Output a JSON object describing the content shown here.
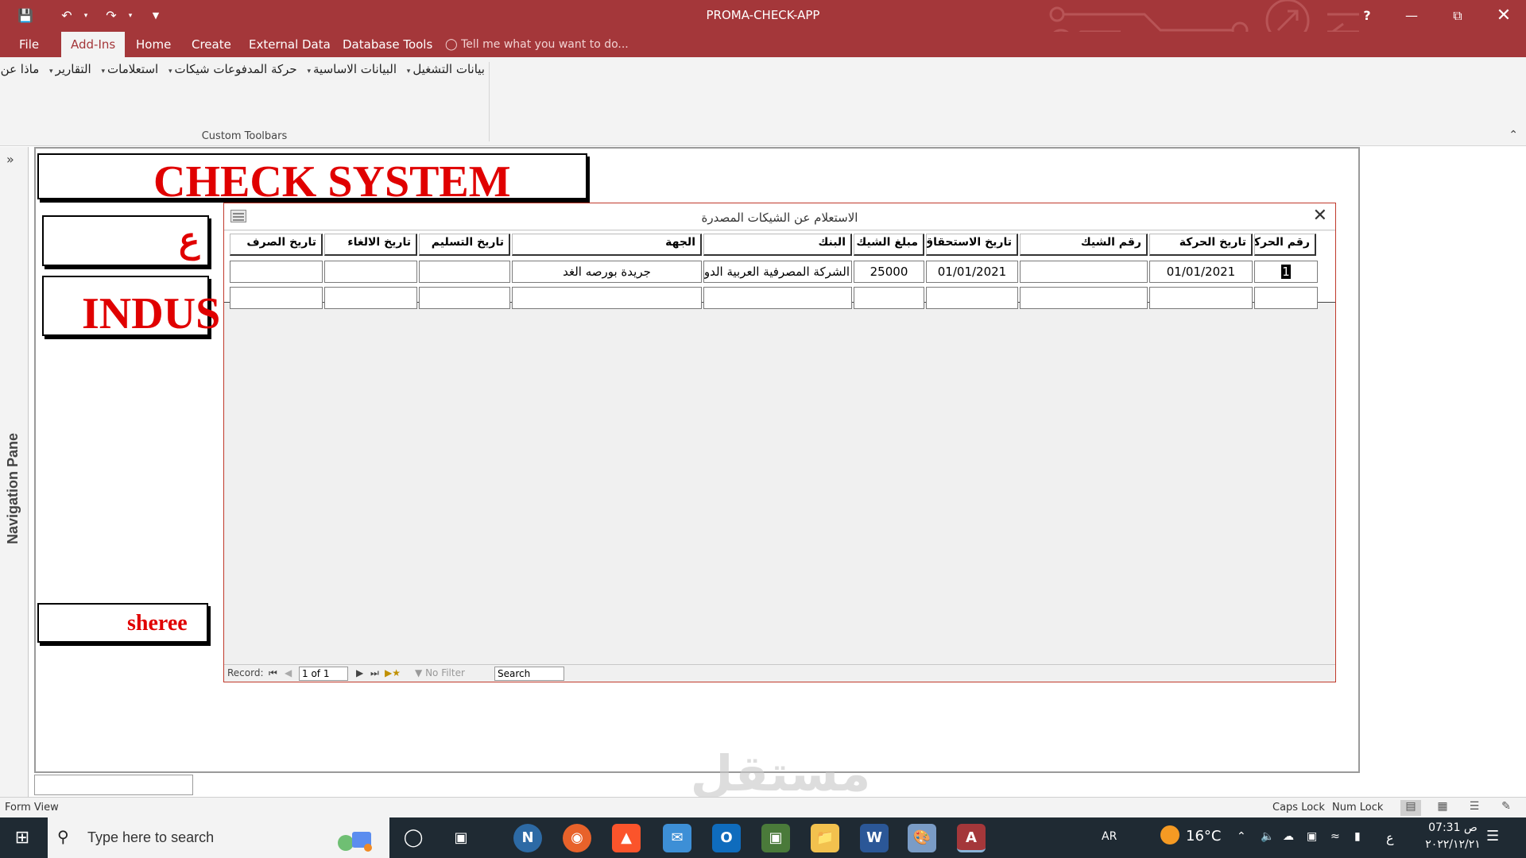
{
  "app": {
    "title": "PROMA-CHECK-APP",
    "help_label": "?"
  },
  "ribbon": {
    "tabs": [
      "File",
      "Add-Ins",
      "Home",
      "Create",
      "External Data",
      "Database Tools"
    ],
    "active_tab": "Add-Ins",
    "tell_me": "Tell me what you want to do...",
    "custom_menu": [
      "بيانات التشغيل",
      "البيانات الاساسية",
      "حركة المدفوعات شيكات",
      "استعلامات",
      "التقارير",
      "ماذا عن؟"
    ],
    "group_label": "Custom Toolbars"
  },
  "nav_pane": {
    "label": "Navigation Pane"
  },
  "background_form": {
    "title": "CHECK SYSTEM",
    "fragment_1": "ع",
    "fragment_2": "INDUS",
    "fragment_3": "sheree"
  },
  "popup": {
    "title": "الاستعلام عن الشيكات المصدرة",
    "columns": [
      "رقم الحركة",
      "تاريخ الحركة",
      "رقم الشيك",
      "تاريخ الاستحقاق",
      "مبلغ الشيك",
      "البنك",
      "الجهة",
      "تاريخ التسليم",
      "تاريخ الالغاء",
      "تاريخ الصرف"
    ],
    "rows": [
      [
        "1",
        "01/01/2021",
        "",
        "01/01/2021",
        "25000",
        "الشركة المصرفية العربية الدو",
        "جريدة بورصه الغد",
        "",
        "",
        ""
      ],
      [
        "",
        "",
        "",
        "",
        "",
        "",
        "",
        "",
        "",
        ""
      ]
    ],
    "record_nav": {
      "label": "Record:",
      "position": "1 of 1",
      "filter": "No Filter",
      "search": "Search"
    }
  },
  "status": {
    "view": "Form View",
    "caps": "Caps Lock",
    "num": "Num Lock"
  },
  "taskbar": {
    "search_placeholder": "Type here to search",
    "lang": "AR",
    "temp": "16°C",
    "ime": "ع",
    "time": "07:31 ص",
    "date": "٢٠٢٢/١٢/٢١"
  },
  "colors": {
    "access_red": "#a4373a",
    "title_red": "#e00000"
  }
}
